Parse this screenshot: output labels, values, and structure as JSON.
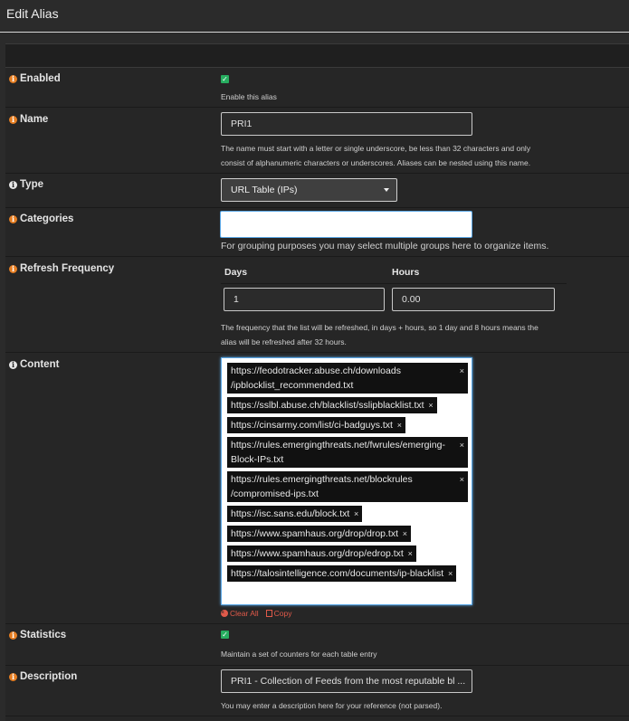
{
  "header": {
    "title": "Edit Alias"
  },
  "fields": {
    "enabled": {
      "label": "Enabled",
      "help": "Enable this alias",
      "checked": true
    },
    "name": {
      "label": "Name",
      "value": "PRI1",
      "help_line1": "The name must start with a letter or single underscore, be less than 32 characters and only",
      "help_line2": "consist of alphanumeric characters or underscores. Aliases can be nested using this name."
    },
    "type": {
      "label": "Type",
      "value": "URL Table (IPs)"
    },
    "categories": {
      "label": "Categories",
      "value": "",
      "help": "For grouping purposes you may select multiple groups here to organize items."
    },
    "refresh": {
      "label": "Refresh Frequency",
      "days_label": "Days",
      "hours_label": "Hours",
      "days_value": "1",
      "hours_value": "0.00",
      "help_line1": "The frequency that the list will be refreshed, in days + hours, so 1 day and 8 hours means the",
      "help_line2": "alias will be refreshed after 32 hours."
    },
    "content": {
      "label": "Content",
      "items": [
        {
          "line1": "https://feodotracker.abuse.ch/downloads",
          "line2": "/ipblocklist_recommended.txt"
        },
        {
          "line1": "https://sslbl.abuse.ch/blacklist/sslipblacklist.txt",
          "line2": ""
        },
        {
          "line1": "https://cinsarmy.com/list/ci-badguys.txt",
          "line2": ""
        },
        {
          "line1": "https://rules.emergingthreats.net/fwrules/emerging-",
          "line2": "Block-IPs.txt"
        },
        {
          "line1": "https://rules.emergingthreats.net/blockrules",
          "line2": "/compromised-ips.txt"
        },
        {
          "line1": "https://isc.sans.edu/block.txt",
          "line2": ""
        },
        {
          "line1": "https://www.spamhaus.org/drop/drop.txt",
          "line2": ""
        },
        {
          "line1": "https://www.spamhaus.org/drop/edrop.txt",
          "line2": ""
        },
        {
          "line1": "https://talosintelligence.com/documents/ip-blacklist",
          "line2": ""
        }
      ],
      "remove_glyph": "×",
      "clear_all": "Clear All",
      "copy": "Copy"
    },
    "statistics": {
      "label": "Statistics",
      "help": "Maintain a set of counters for each table entry",
      "checked": true
    },
    "description": {
      "label": "Description",
      "value": "PRI1 - Collection of Feeds from the most reputable bl ...",
      "help": "You may enter a description here for your reference (not parsed)."
    }
  },
  "icons": {
    "info": "info-circle-icon",
    "check": "checkmark-icon",
    "caret": "caret-down-icon",
    "clear": "times-circle-icon",
    "copy": "copy-icon"
  },
  "colors": {
    "accent_orange": "#e67e22",
    "check_green": "#27ae60",
    "link_red": "#e05a4a"
  }
}
